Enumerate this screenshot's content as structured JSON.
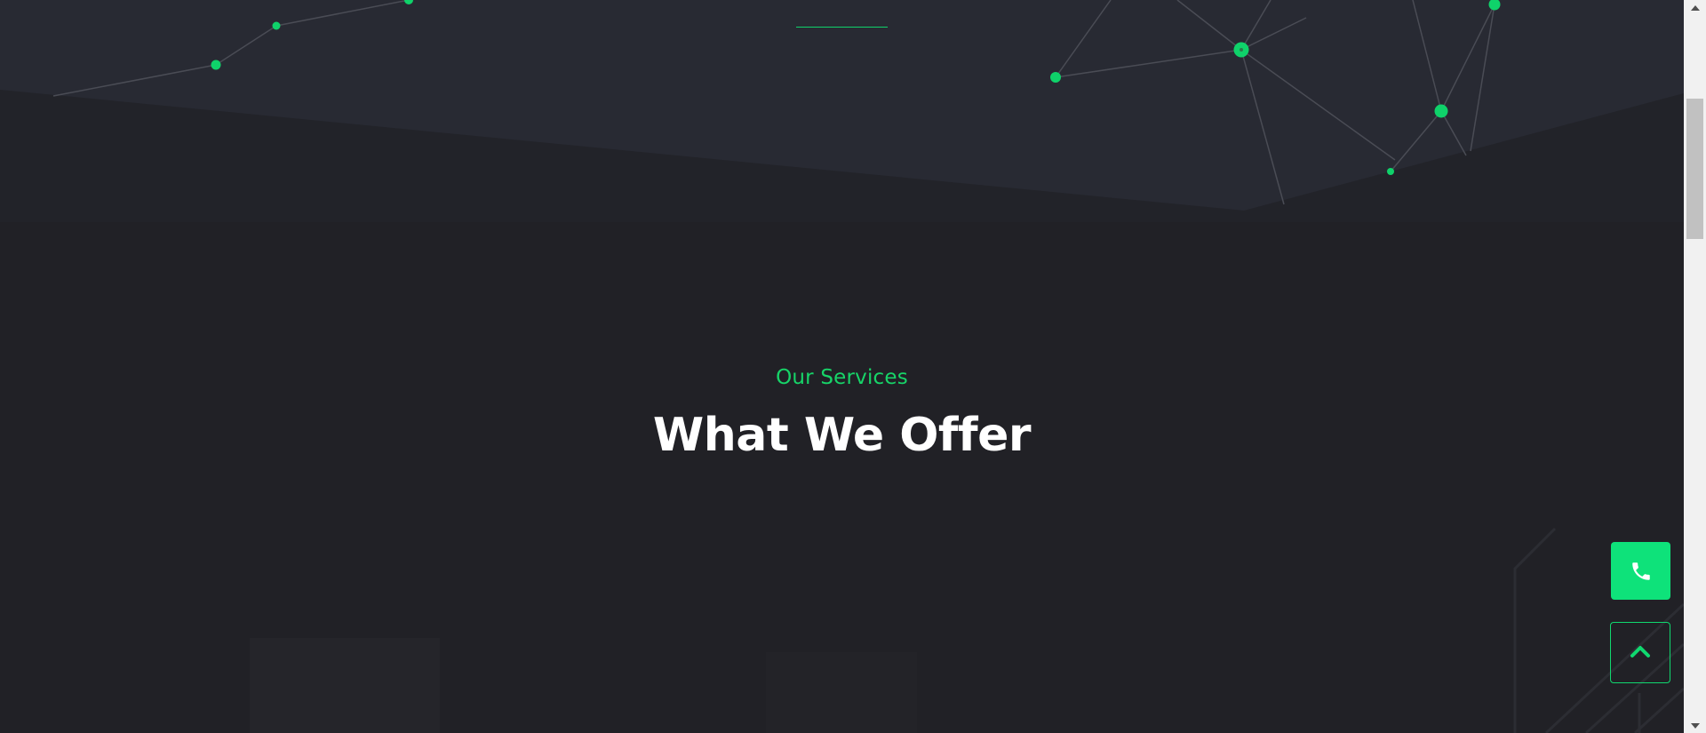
{
  "services": {
    "subtitle": "Our Services",
    "title": "What We Offer"
  },
  "floating": {
    "phone_icon": "phone-icon",
    "top_icon": "chevron-up-icon"
  },
  "colors": {
    "accent": "#0ee27a",
    "background": "#212126",
    "hero_band": "#282a33",
    "title": "#ffffff"
  }
}
